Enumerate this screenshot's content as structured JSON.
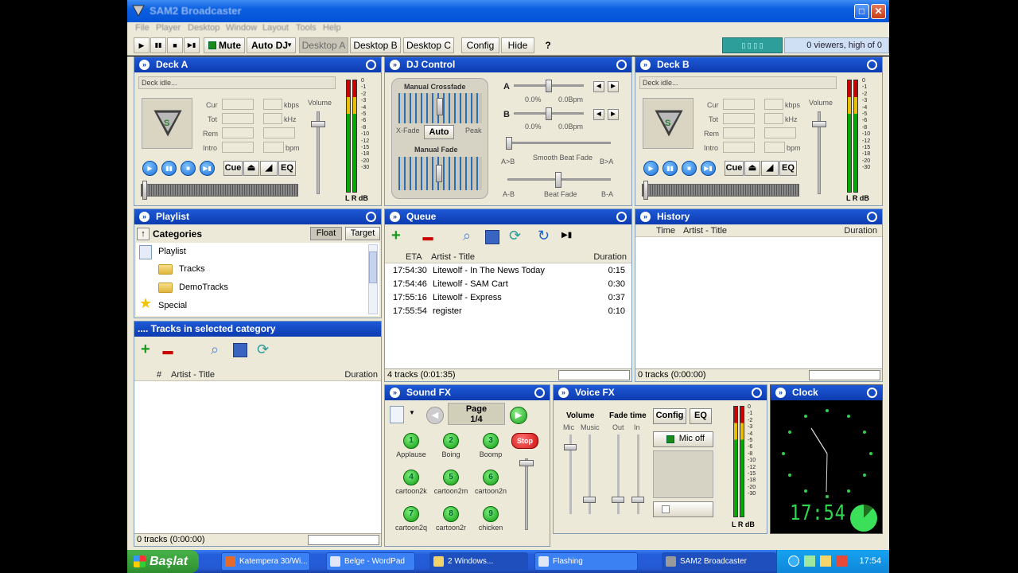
{
  "window": {
    "title": "SAM2 Broadcaster"
  },
  "menu": [
    "File",
    "Player",
    "Desktop",
    "Window",
    "Layout",
    "Tools",
    "Help"
  ],
  "toolbar": {
    "play": "▶",
    "pause": "▮▮",
    "stop": "■",
    "next": "▶▮",
    "mute": "Mute",
    "auto_dj": "Auto DJ",
    "desktop_a": "Desktop A",
    "desktop_b": "Desktop B",
    "desktop_c": "Desktop C",
    "config": "Config",
    "hide": "Hide",
    "help": "?",
    "viewers": "0 viewers, high of 0"
  },
  "deck_a": {
    "title": "Deck A",
    "status": "Deck idle...",
    "labels": {
      "cur": "Cur",
      "tot": "Tot",
      "rem": "Rem",
      "intro": "Intro",
      "kbps": "kbps",
      "khz": "kHz",
      "bpm": "bpm",
      "volume": "Volume",
      "meter": "L R dB"
    },
    "buttons": {
      "cue": "Cue",
      "eq": "EQ"
    }
  },
  "deck_b": {
    "title": "Deck B",
    "status": "Deck idle...",
    "labels": {
      "cur": "Cur",
      "tot": "Tot",
      "rem": "Rem",
      "intro": "Intro",
      "kbps": "kbps",
      "khz": "kHz",
      "bpm": "bpm",
      "volume": "Volume",
      "meter": "L R dB"
    },
    "buttons": {
      "cue": "Cue",
      "eq": "EQ"
    }
  },
  "meter_scale": [
    "0",
    "-1",
    "-2",
    "-3",
    "-4",
    "-5",
    "-6",
    "-8",
    "-10",
    "-12",
    "-15",
    "-18",
    "-20",
    "-30"
  ],
  "dj_control": {
    "title": "DJ Control",
    "manual_crossfade": "Manual Crossfade",
    "xfade": "X-Fade",
    "auto": "Auto",
    "peak": "Peak",
    "manual_fade": "Manual Fade",
    "a": "A",
    "b": "B",
    "a_pct": "0.0%",
    "a_bpm": "0.0Bpm",
    "b_pct": "0.0%",
    "b_bpm": "0.0Bpm",
    "smooth_beat_fade": "Smooth Beat Fade",
    "a_to_b": "A>B",
    "b_to_a": "B>A",
    "beat_fade": "Beat Fade",
    "a_b": "A-B",
    "b_a": "B-A"
  },
  "playlist": {
    "title": "Playlist",
    "categories": "Categories",
    "float": "Float",
    "target": "Target",
    "tree": {
      "root": "Playlist",
      "tracks": "Tracks",
      "demo": "DemoTracks",
      "special": "Special"
    }
  },
  "tracks_category": {
    "title": ".... Tracks in selected category",
    "col_num": "#",
    "col_artist": "Artist - Title",
    "col_duration": "Duration",
    "status": "0 tracks (0:00:00)"
  },
  "queue": {
    "title": "Queue",
    "col_eta": "ETA",
    "col_artist": "Artist - Title",
    "col_duration": "Duration",
    "rows": [
      {
        "eta": "17:54:30",
        "title": "Litewolf - In The News Today",
        "dur": "0:15"
      },
      {
        "eta": "17:54:46",
        "title": "Litewolf - SAM Cart",
        "dur": "0:30"
      },
      {
        "eta": "17:55:16",
        "title": "Litewolf - Express",
        "dur": "0:37"
      },
      {
        "eta": "17:55:54",
        "title": "register",
        "dur": "0:10"
      }
    ],
    "status": "4 tracks (0:01:35)"
  },
  "history": {
    "title": "History",
    "col_time": "Time",
    "col_artist": "Artist - Title",
    "col_duration": "Duration",
    "status": "0 tracks (0:00:00)"
  },
  "sound_fx": {
    "title": "Sound FX",
    "page": "Page",
    "page_num": "1/4",
    "stop": "Stop",
    "pads": [
      {
        "num": "1",
        "label": "Applause"
      },
      {
        "num": "2",
        "label": "Boing"
      },
      {
        "num": "3",
        "label": "Boomp"
      },
      {
        "num": "4",
        "label": "cartoon2k"
      },
      {
        "num": "5",
        "label": "cartoon2m"
      },
      {
        "num": "6",
        "label": "cartoon2n"
      },
      {
        "num": "7",
        "label": "cartoon2q"
      },
      {
        "num": "8",
        "label": "cartoon2r"
      },
      {
        "num": "9",
        "label": "chicken"
      }
    ]
  },
  "voice_fx": {
    "title": "Voice FX",
    "volume": "Volume",
    "fade_time": "Fade time",
    "mic": "Mic",
    "music": "Music",
    "out": "Out",
    "in": "In",
    "config": "Config",
    "eq": "EQ",
    "mic_off": "Mic off",
    "meter": "L R dB"
  },
  "clock": {
    "title": "Clock",
    "time": "17:54"
  },
  "taskbar": {
    "start": "Başlat",
    "tasks": [
      "Katempera 30/Wi...",
      "Belge - WordPad",
      "2 Windows...",
      "Flashing",
      "SAM2 Broadcaster"
    ],
    "clock": "17:54"
  },
  "colors": {
    "title_blue": "#0d3bb0",
    "panel_bg": "#ece9d8",
    "accent_green": "#0f9a0f",
    "stop_red": "#e02020",
    "clock_green": "#31e25a"
  }
}
